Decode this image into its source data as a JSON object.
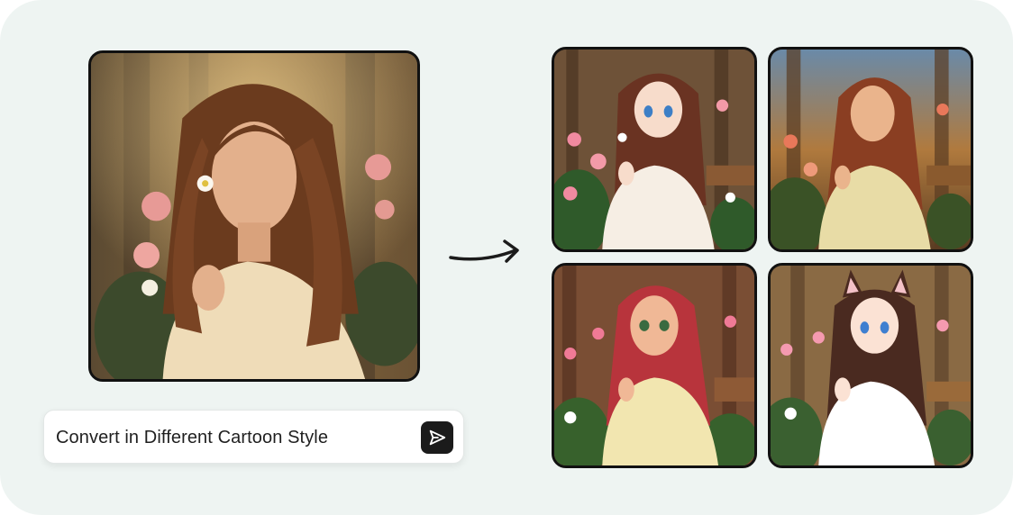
{
  "prompt": {
    "text": "Convert in Different Cartoon Style",
    "send_icon": "send-icon"
  },
  "images": {
    "source": {
      "kind": "photo",
      "subject": "source-portrait"
    },
    "results": [
      "cartoon-anime-1",
      "cartoon-painted-2",
      "cartoon-3d-3",
      "cartoon-catgirl-4"
    ]
  },
  "colors": {
    "background": "#eef4f2",
    "frame_border": "#111111",
    "send_button": "#1b1b1b"
  },
  "arrow_icon": "arrow-right-icon"
}
